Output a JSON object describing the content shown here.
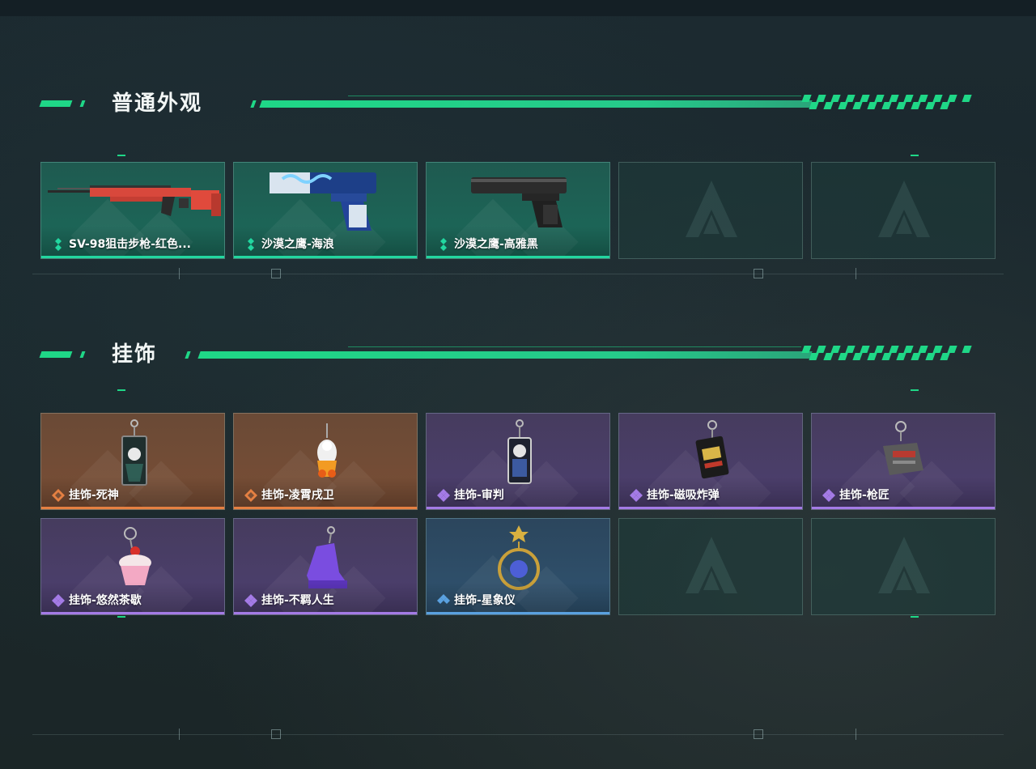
{
  "sections": [
    {
      "title": "普通外观",
      "items": [
        {
          "name": "SV-98狙击步枪-红色...",
          "rarity": "green",
          "icon": "rifle-icon"
        },
        {
          "name": "沙漠之鹰-海浪",
          "rarity": "green",
          "icon": "pistol-wave-icon"
        },
        {
          "name": "沙漠之鹰-高雅黑",
          "rarity": "green",
          "icon": "pistol-black-icon"
        },
        {
          "name": "",
          "rarity": "empty",
          "icon": "placeholder-logo-icon"
        },
        {
          "name": "",
          "rarity": "empty",
          "icon": "placeholder-logo-icon"
        }
      ]
    },
    {
      "title": "挂饰",
      "items": [
        {
          "name": "挂饰-死神",
          "rarity": "orange",
          "icon": "charm-reaper-icon"
        },
        {
          "name": "挂饰-凌霄戌卫",
          "rarity": "orange",
          "icon": "charm-guard-icon"
        },
        {
          "name": "挂饰-审判",
          "rarity": "purple",
          "icon": "charm-judgement-icon"
        },
        {
          "name": "挂饰-磁吸炸弹",
          "rarity": "purple",
          "icon": "charm-bomb-icon"
        },
        {
          "name": "挂饰-枪匠",
          "rarity": "purple",
          "icon": "charm-gunsmith-icon"
        },
        {
          "name": "挂饰-悠然茶歇",
          "rarity": "purple",
          "icon": "charm-cupcake-icon"
        },
        {
          "name": "挂饰-不羁人生",
          "rarity": "purple",
          "icon": "charm-sneaker-icon"
        },
        {
          "name": "挂饰-星象仪",
          "rarity": "blue",
          "icon": "charm-astrolabe-icon"
        },
        {
          "name": "",
          "rarity": "empty",
          "icon": "placeholder-logo-icon"
        },
        {
          "name": "",
          "rarity": "empty",
          "icon": "placeholder-logo-icon"
        }
      ]
    }
  ],
  "colors": {
    "accent": "#1fd787",
    "rarity_green": "#22d7a0",
    "rarity_orange": "#e58042",
    "rarity_purple": "#a47be6",
    "rarity_blue": "#5aa1e0",
    "background": "#1b2a2e"
  }
}
